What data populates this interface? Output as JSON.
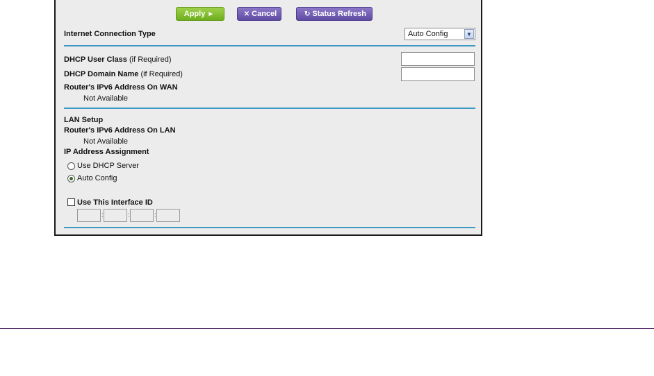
{
  "toolbar": {
    "apply_label": "Apply",
    "apply_icon": "►",
    "cancel_label": "Cancel",
    "cancel_icon": "✕",
    "refresh_label": "Status Refresh",
    "refresh_icon": "↻"
  },
  "connection": {
    "label": "Internet Connection Type",
    "selected": "Auto Config",
    "arrow_icon": "▼"
  },
  "wan": {
    "dhcp_user_class_label": "DHCP User Class",
    "dhcp_user_class_hint": "(if Required)",
    "dhcp_user_class_value": "",
    "dhcp_domain_label": "DHCP Domain Name",
    "dhcp_domain_hint": "(if Required)",
    "dhcp_domain_value": "",
    "ipv6_wan_label": "Router's IPv6 Address On WAN",
    "ipv6_wan_value": "Not Available"
  },
  "lan": {
    "section_title": "LAN Setup",
    "ipv6_lan_label": "Router's IPv6 Address On LAN",
    "ipv6_lan_value": "Not Available",
    "assignment_label": "IP Address Assignment",
    "option_dhcp": "Use DHCP Server",
    "option_auto": "Auto Config",
    "selected_option": "Auto Config",
    "interface_id_label": "Use This Interface ID",
    "interface_id_checked": false,
    "interface_id_separator": ":"
  },
  "colors": {
    "apply": "#7cbf2a",
    "cancel": "#6b59b3",
    "divider": "#3d9ac2",
    "page_rule": "#5a2d6e"
  }
}
